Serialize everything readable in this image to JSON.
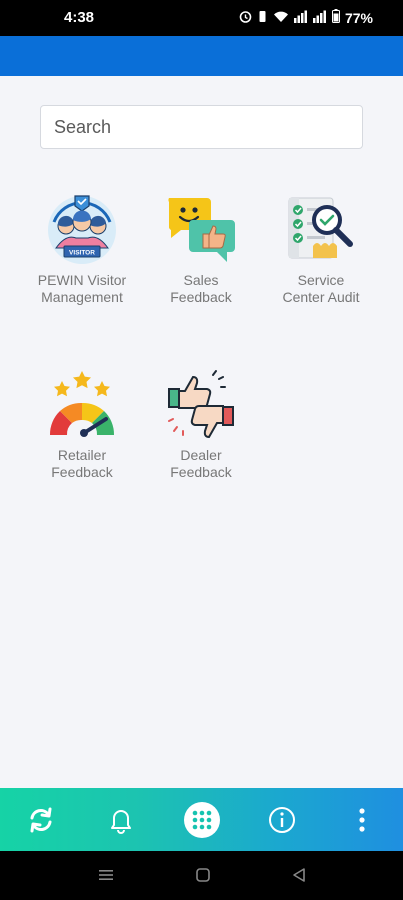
{
  "status_bar": {
    "time": "4:38",
    "battery": "77%"
  },
  "search": {
    "placeholder": "Search"
  },
  "tiles": [
    {
      "label_line1": "PEWIN Visitor",
      "label_line2": "Management",
      "icon": "visitor-management-icon",
      "badge": "VISITOR"
    },
    {
      "label_line1": "Sales",
      "label_line2": "Feedback",
      "icon": "sales-feedback-icon"
    },
    {
      "label_line1": "Service",
      "label_line2": "Center Audit",
      "icon": "service-audit-icon"
    },
    {
      "label_line1": "Retailer",
      "label_line2": "Feedback",
      "icon": "retailer-feedback-icon"
    },
    {
      "label_line1": "Dealer",
      "label_line2": "Feedback",
      "icon": "dealer-feedback-icon"
    }
  ],
  "bottom_nav": {
    "items": [
      "refresh-icon",
      "bell-icon",
      "grid-icon",
      "info-icon",
      "more-vertical-icon"
    ]
  },
  "colors": {
    "app_bar": "#0a6fd8",
    "background": "#f4f5f9",
    "nav_gradient_start": "#16d3a6",
    "nav_gradient_end": "#1f8fe0"
  }
}
